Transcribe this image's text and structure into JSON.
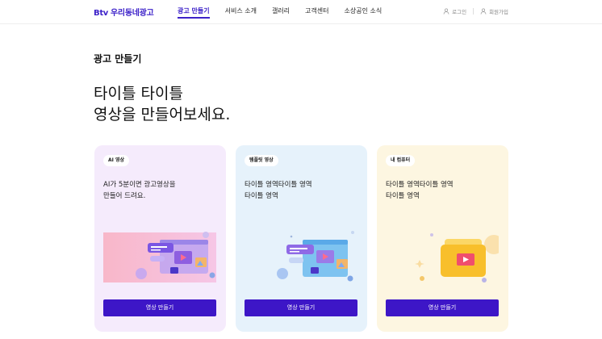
{
  "header": {
    "logo_btv": "Btv",
    "logo_name": "우리동네광고",
    "nav": [
      {
        "label": "광고 만들기",
        "active": true
      },
      {
        "label": "서비스 소개",
        "active": false
      },
      {
        "label": "갤러리",
        "active": false
      },
      {
        "label": "고객센터",
        "active": false
      },
      {
        "label": "소상공인 소식",
        "active": false
      }
    ],
    "login": "로그인",
    "signup": "회원가입"
  },
  "page": {
    "section_title": "광고 만들기",
    "hero_line1": "타이틀 타이틀",
    "hero_line2": "영상을 만들어보세요."
  },
  "cards": [
    {
      "badge": "AI 영상",
      "desc_line1": " AI가 5분이면 광고영상을",
      "desc_line2": "만들어 드려요.",
      "button": "영상 만들기",
      "illustration": "video-editor-window-pink"
    },
    {
      "badge": "템플릿 영상",
      "desc_line1": "타이틀 영역타이틀 영역",
      "desc_line2": "타이틀 영역",
      "button": "영상 만들기",
      "illustration": "video-editor-window-blue"
    },
    {
      "badge": "내 컴퓨터",
      "desc_line1": "타이틀 영역타이틀 영역",
      "desc_line2": "타이틀 영역",
      "button": "영상 만들기",
      "illustration": "yellow-folder-video"
    }
  ],
  "colors": {
    "brand": "#3d22c9",
    "button": "#3d16c7",
    "card1_bg": "#f5ebfc",
    "card2_bg": "#e6f2fb",
    "card3_bg": "#fdf6e1"
  }
}
